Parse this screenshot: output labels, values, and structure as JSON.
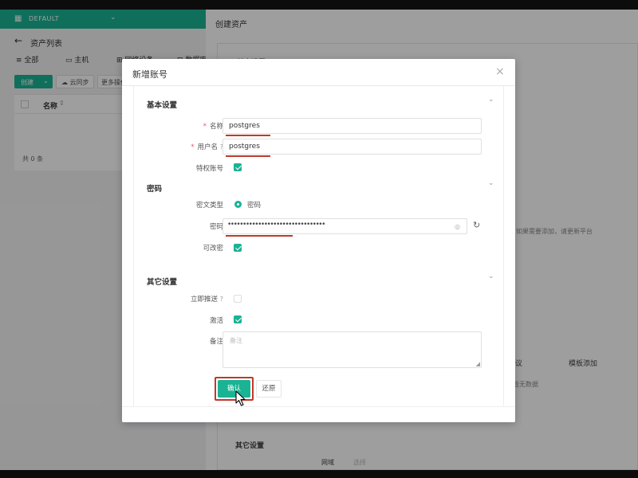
{
  "org": {
    "name": "DEFAULT",
    "icon": "building-icon",
    "caret": "chevron-down-icon"
  },
  "left": {
    "title": "资产列表",
    "tabs": [
      {
        "label": "全部",
        "icon": "list-icon"
      },
      {
        "label": "主机",
        "icon": "monitor-icon"
      },
      {
        "label": "网络设备",
        "icon": "network-icon"
      },
      {
        "label": "数据库",
        "icon": "database-icon"
      }
    ],
    "toolbar": {
      "create": "创建",
      "sync": "云同步",
      "more": "更多操作"
    },
    "table": {
      "col_name": "名称",
      "total": "共 0 条"
    }
  },
  "right": {
    "title": "创建资产",
    "basic": "基本设置",
    "hint": "如果需要添加，请更新平台",
    "col_protocol": "协议",
    "col_template": "模板添加",
    "empty": "暂无数据",
    "other": "其它设置",
    "node_label": "网域",
    "node_ph": "选择"
  },
  "modal": {
    "title": "新增账号",
    "basic_section": "基本设置",
    "name_label": "名称",
    "name_value": "postgres",
    "username_label": "用户名",
    "username_value": "postgres",
    "privileged_label": "特权账号",
    "password_section": "密码",
    "secret_type_label": "密文类型",
    "secret_type_value": "密码",
    "password_label": "密码",
    "password_value": "••••••••••••••••••••••••••••••••",
    "changeable_label": "可改密",
    "other_section": "其它设置",
    "push_label": "立即推送",
    "active_label": "激活",
    "comment_label": "备注",
    "comment_placeholder": "备注",
    "confirm": "确认",
    "reset": "还原"
  },
  "state": {
    "privileged": true,
    "changeable": true,
    "push_now": false,
    "active": true
  },
  "colors": {
    "accent": "#1ab394",
    "highlight": "#c0392b",
    "required": "#ed5565"
  }
}
